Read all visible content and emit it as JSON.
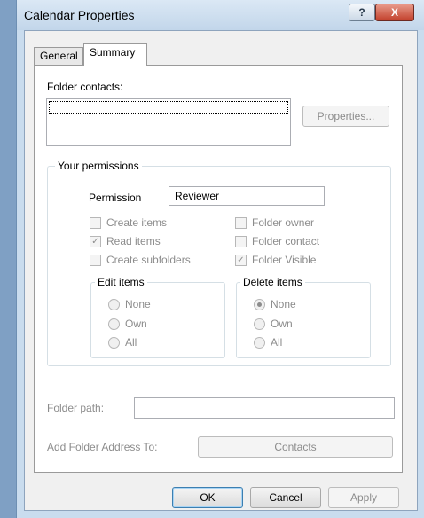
{
  "window": {
    "title": "Calendar Properties",
    "help_glyph": "?",
    "close_glyph": "X"
  },
  "tabs": [
    {
      "label": "General"
    },
    {
      "label": "Summary"
    }
  ],
  "folder_contacts": {
    "label": "Folder contacts:",
    "properties_button": "Properties..."
  },
  "permissions": {
    "group_label": "Your permissions",
    "permission_label": "Permission",
    "permission_value": "Reviewer",
    "checkboxes": [
      {
        "label": "Create items",
        "checked": false
      },
      {
        "label": "Read items",
        "checked": true
      },
      {
        "label": "Create subfolders",
        "checked": false
      },
      {
        "label": "Folder owner",
        "checked": false
      },
      {
        "label": "Folder contact",
        "checked": false
      },
      {
        "label": "Folder Visible",
        "checked": true
      }
    ],
    "edit_items": {
      "label": "Edit items",
      "options": [
        "None",
        "Own",
        "All"
      ],
      "selected": -1
    },
    "delete_items": {
      "label": "Delete items",
      "options": [
        "None",
        "Own",
        "All"
      ],
      "selected": 0
    }
  },
  "folder_path": {
    "label": "Folder path:",
    "value": ""
  },
  "add_folder_address": {
    "label": "Add Folder Address To:",
    "button": "Contacts"
  },
  "footer": {
    "ok": "OK",
    "cancel": "Cancel",
    "apply": "Apply"
  },
  "check_glyph": "✓"
}
